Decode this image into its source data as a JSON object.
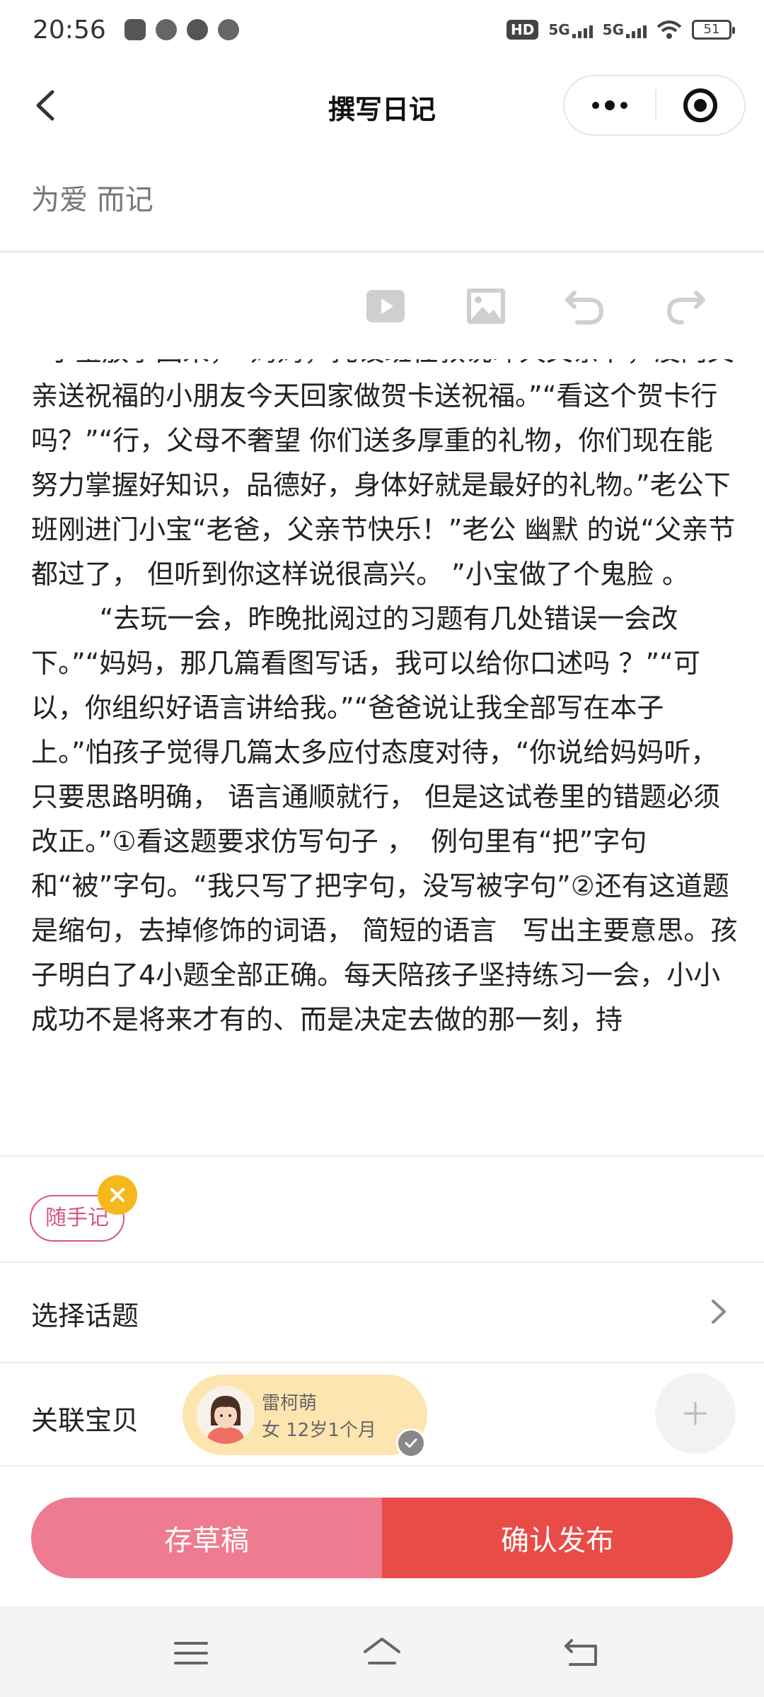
{
  "status_bar": {
    "time": "20:56",
    "hd_label": "HD",
    "signal1": "5G",
    "signal2": "5G",
    "battery": "51"
  },
  "nav": {
    "title": "撰写日记"
  },
  "diary": {
    "title_value": "为爱 而记",
    "body": "  小宝放学回来，“妈妈，托设班任教说昨天父亲节，没向父亲送祝福的小朋友今天回家做贺卡送祝福。”“看这个贺卡行吗？”“行，父母不奢望 你们送多厚重的礼物，你们现在能努力掌握好知识，品德好，身体好就是最好的礼物。”老公下班刚进门小宝“老爸，父亲节快乐！”老公 幽默 的说“父亲节都过了， 但听到你这样说很高兴。 ”小宝做了个鬼脸 。\n        “去玩一会，昨晚批阅过的习题有几处错误一会改下。”“妈妈，那几篇看图写话，我可以给你口述吗 ？”“可以，你组织好语言讲给我。”“爸爸说让我全部写在本子上。”怕孩子觉得几篇太多应付态度对待，“你说给妈妈听，只要思路明确， 语言通顺就行， 但是这试卷里的错题必须改正。”①看这题要求仿写句子 ，  例句里有“把”字句和“被”字句。“我只写了把字句，没写被字句”②还有这道题是缩句，去掉修饰的词语， 简短的语言   写出主要意思。孩子明白了4小题全部正确。每天陪孩子坚持练习一会，小小 成功不是将来才有的、而是决定去做的那一刻，持"
  },
  "tag": {
    "label": "随手记"
  },
  "topic": {
    "label": "选择话题"
  },
  "baby": {
    "label": "关联宝贝",
    "name": "雷柯萌",
    "info": "女  12岁1个月"
  },
  "actions": {
    "draft_label": "存草稿",
    "publish_label": "确认发布"
  },
  "colors": {
    "draft": "#ee7b8f",
    "publish": "#e94b47",
    "tag": "#d9557e",
    "tag_close": "#f5b91e",
    "baby_card": "#fde5b0"
  },
  "icons": {
    "toolbar": [
      "video-icon",
      "image-icon",
      "undo-icon",
      "redo-icon"
    ]
  }
}
